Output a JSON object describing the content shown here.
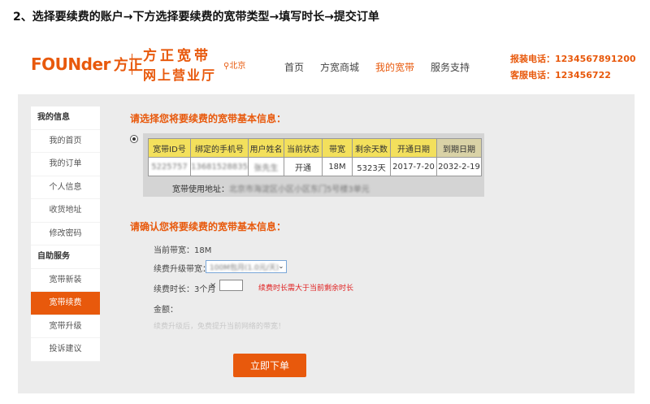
{
  "step_title": "2、选择要续费的账户→下方选择要续费的宽带类型→填写时长→提交订单",
  "header": {
    "logo_en": "FOUNder",
    "logo_cn": "方正",
    "brand_line1": "方正宽带",
    "brand_line2": "网上营业厅",
    "location": "北京",
    "nav": [
      {
        "label": "首页",
        "active": false
      },
      {
        "label": "方宽商城",
        "active": false
      },
      {
        "label": "我的宽带",
        "active": true
      },
      {
        "label": "服务支持",
        "active": false
      }
    ],
    "install_phone_label": "报装电话：",
    "install_phone": "1234567891200",
    "service_phone_label": "客服电话：",
    "service_phone": "123456722"
  },
  "sidebar": {
    "groups": [
      {
        "title": "我的信息",
        "items": [
          "我的首页",
          "我的订单",
          "个人信息",
          "收货地址",
          "修改密码"
        ]
      },
      {
        "title": "自助服务",
        "items": [
          "宽带新装",
          "宽带续费",
          "宽带升级",
          "投诉建议"
        ]
      }
    ],
    "active_item": "宽带续费"
  },
  "select_section": {
    "title": "请选择您将要续费的宽带基本信息：",
    "headers": [
      "宽带ID号",
      "绑定的手机号",
      "用户姓名",
      "当前状态",
      "带宽",
      "剩余天数",
      "开通日期",
      "到期日期"
    ],
    "row": [
      "5225757",
      "13681528835",
      "张先生",
      "开通",
      "18M",
      "5323天",
      "2017-7-20",
      "2032-2-19"
    ],
    "address_label": "宽带使用地址：",
    "address_value": "北京市海淀区小区小区东门5号楼3单元"
  },
  "confirm_section": {
    "title": "请确认您将要续费的宽带基本信息：",
    "current_bandwidth": "当前带宽：18M",
    "upgrade_label": "续费升级带宽：",
    "upgrade_value": "100M包月(1.0元/天)",
    "duration_label": "续费时长：3个月",
    "times_sign": "×",
    "duration_value": "",
    "duration_warning": "续费时长需大于当前剩余时长",
    "amount_label": "金额：",
    "note": "续费升级后，免费提升当前网络的带宽！",
    "submit_label": "立即下单"
  },
  "icons": {
    "location": "map-pin-icon",
    "dropdown": "chevron-down-icon"
  },
  "colors": {
    "brand": "#e8590c",
    "table_header": "#f3e05c",
    "warning": "#e02020"
  }
}
